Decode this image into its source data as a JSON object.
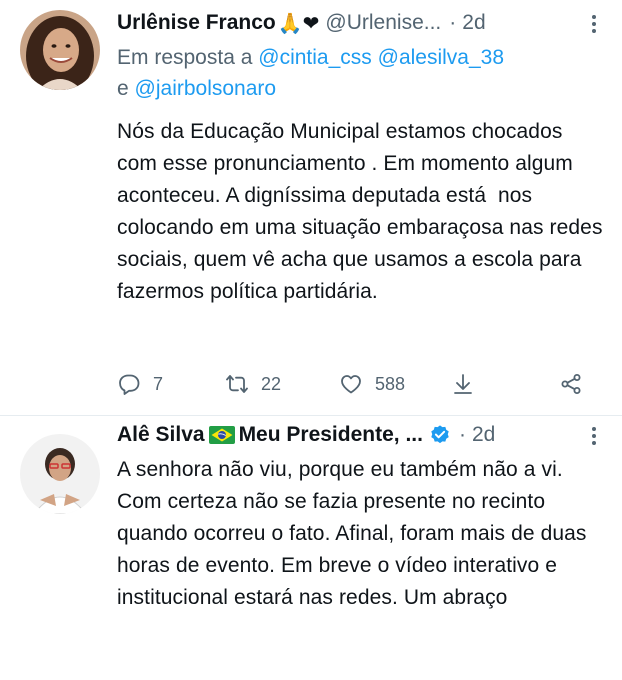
{
  "tweets": [
    {
      "name": "Urlênise Franco",
      "name_emoji": "🙏❤",
      "handle": "@Urlenise...",
      "time": "2d",
      "reply_prefix": "Em resposta a",
      "reply_mentions": [
        "@cintia_css",
        "@alesilva_38"
      ],
      "reply_and": "e",
      "reply_last": "@jairbolsonaro",
      "text": "Nós da Educação Municipal estamos chocados com esse pronunciamento . Em momento algum aconteceu. A digníssima deputada está  nos   colocando em uma situação embaraçosa nas redes sociais, quem vê acha que usamos a escola para fazermos política partidária.",
      "replies": "7",
      "retweets": "22",
      "likes": "588"
    },
    {
      "name_prefix": "Alê Silva",
      "name_suffix": "Meu Presidente, ...",
      "time": "2d",
      "text": "A senhora não viu, porque eu também não a vi. Com certeza não se fazia presente no recinto quando ocorreu o fato. Afinal, foram mais de duas horas de evento. Em breve o vídeo interativo e institucional estará nas redes. Um abraço"
    }
  ],
  "icons": {
    "reply": "reply-icon",
    "retweet": "retweet-icon",
    "like": "heart-icon",
    "download": "download-icon",
    "share": "share-icon",
    "verified": "verified-badge-icon",
    "flag": "brazil-flag-icon",
    "more": "more-options-icon"
  },
  "colors": {
    "link": "#1d9bf0",
    "secondary": "#536471",
    "text": "#0f1419"
  }
}
